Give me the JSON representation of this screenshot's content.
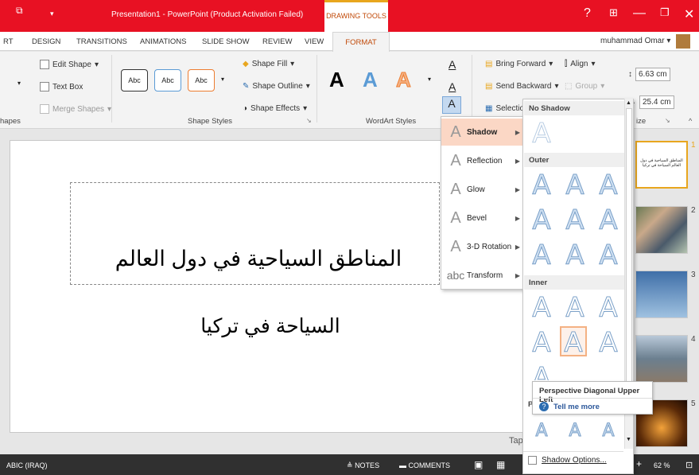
{
  "titlebar": {
    "title": "Presentation1 - PowerPoint (Product Activation Failed)",
    "drawing_tools": "DRAWING TOOLS"
  },
  "tabs": [
    "RT",
    "DESIGN",
    "TRANSITIONS",
    "ANIMATIONS",
    "SLIDE SHOW",
    "REVIEW",
    "VIEW"
  ],
  "format_tab": "FORMAT",
  "user": "muhammad Omar",
  "ribbon": {
    "insert_shapes": {
      "edit_shape": "Edit Shape",
      "text_box": "Text Box",
      "merge_shapes": "Merge Shapes",
      "label": "hapes"
    },
    "shape_styles": {
      "abc": "Abc",
      "shape_fill": "Shape Fill",
      "shape_outline": "Shape Outline",
      "shape_effects": "Shape Effects",
      "label": "Shape Styles"
    },
    "wordart": {
      "a": "A",
      "label": "WordArt Styles"
    },
    "arrange": {
      "bring_forward": "Bring Forward",
      "send_backward": "Send Backward",
      "selection": "Selection",
      "align": "Align",
      "group": "Group"
    },
    "size": {
      "height": "6.63 cm",
      "width": "25.4 cm",
      "label": "ize"
    }
  },
  "slide": {
    "title": "المناطق السياحية في دول العالم",
    "subtitle": "السياحة في تركيا"
  },
  "thumbnails": [
    {
      "num": "1",
      "text": "المناطق السياحية في دول العالم السياحة في تركيا"
    },
    {
      "num": "2"
    },
    {
      "num": "3"
    },
    {
      "num": "4"
    },
    {
      "num": "5"
    }
  ],
  "notes_label": "Tap",
  "statusbar": {
    "language": "ABIC (IRAQ)",
    "notes": "NOTES",
    "comments": "COMMENTS",
    "zoom": "62 %"
  },
  "text_effects_menu": [
    {
      "label": "Shadow",
      "icon": "A"
    },
    {
      "label": "Reflection",
      "icon": "A"
    },
    {
      "label": "Glow",
      "icon": "A"
    },
    {
      "label": "Bevel",
      "icon": "A"
    },
    {
      "label": "3-D Rotation",
      "icon": "A"
    },
    {
      "label": "Transform",
      "icon": "abc"
    }
  ],
  "shadow_gallery": {
    "no_shadow": "No Shadow",
    "outer": "Outer",
    "inner": "Inner",
    "perspective_initial": "P",
    "shadow_options": "Shadow Options..."
  },
  "tooltip": {
    "title": "Perspective Diagonal Upper Left",
    "tell_me_more": "Tell me more"
  }
}
